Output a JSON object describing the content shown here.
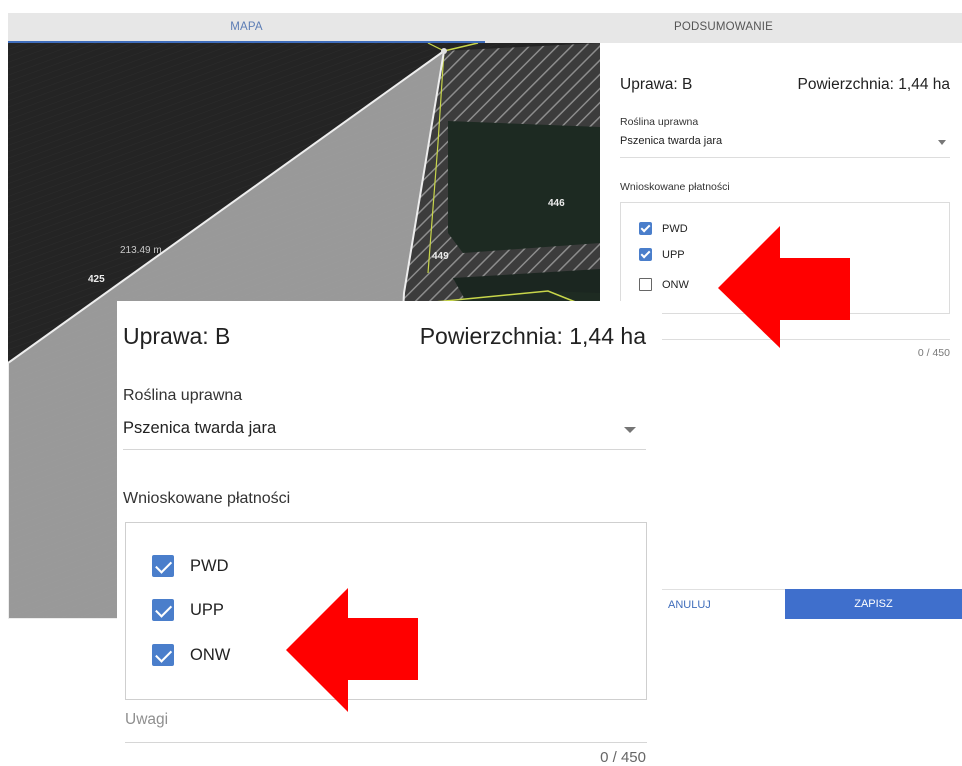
{
  "tabs": [
    {
      "label": "MAPA",
      "active": true
    },
    {
      "label": "PODSUMOWANIE",
      "active": false
    }
  ],
  "map": {
    "labels": {
      "parcel_446": "446",
      "parcel_449": "449",
      "parcel_425": "425",
      "measurement": "213.49 m"
    }
  },
  "form_small": {
    "crop_title": "Uprawa: B",
    "area": "Powierzchnia: 1,44 ha",
    "plant_label": "Roślina uprawna",
    "plant_value": "Pszenica twarda jara",
    "payments_label": "Wnioskowane płatności",
    "payments": [
      {
        "label": "PWD",
        "checked": true
      },
      {
        "label": "UPP",
        "checked": true
      },
      {
        "label": "ONW",
        "checked": false
      }
    ],
    "counter": "0 / 450",
    "cancel_label": "ANULUJ",
    "save_label": "ZAPISZ"
  },
  "form_zoomed": {
    "crop_title": "Uprawa: B",
    "area": "Powierzchnia: 1,44 ha",
    "plant_label": "Roślina uprawna",
    "plant_value": "Pszenica twarda jara",
    "payments_label": "Wnioskowane płatności",
    "payments": [
      {
        "label": "PWD",
        "checked": true
      },
      {
        "label": "UPP",
        "checked": true
      },
      {
        "label": "ONW",
        "checked": true
      }
    ],
    "notes_placeholder": "Uwagi",
    "counter": "0 / 450"
  },
  "colors": {
    "accent": "#3f6fcc",
    "checkbox": "#4a7ecb",
    "arrow": "#ff0000"
  }
}
